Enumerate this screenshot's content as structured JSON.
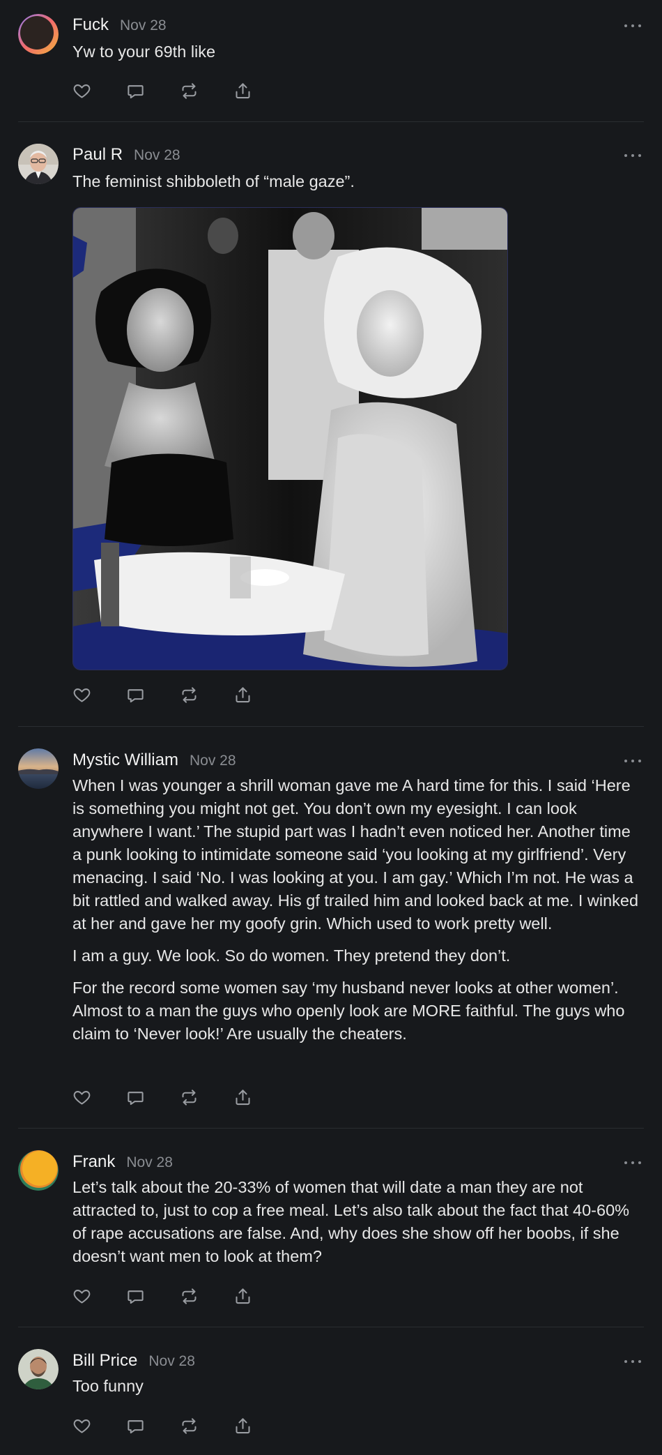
{
  "posts": [
    {
      "author": "Fuck",
      "date": "Nov 28",
      "paragraphs": [
        "Yw to your 69th like"
      ]
    },
    {
      "author": "Paul R",
      "date": "Nov 28",
      "paragraphs": [
        "The feminist shibboleth of “male gaze”."
      ]
    },
    {
      "author": "Mystic William",
      "date": "Nov 28",
      "paragraphs": [
        "When I was younger a shrill woman gave me A hard time for this. I said ‘Here is something you might not get. You don’t own my eyesight. I can look anywhere I want.’ The stupid part was I hadn’t even noticed her. Another time a punk looking to intimidate someone said ‘you looking at my girlfriend’. Very menacing. I said ‘No. I was looking at you. I am gay.’ Which I’m not. He was a bit rattled and walked away. His gf trailed him and looked back at me. I winked at her and gave her my goofy grin. Which used to work pretty well.",
        "I am a guy. We look. So do women. They pretend they don’t.",
        "For the record some women say ‘my husband never looks at other women’. Almost to a man the guys who openly look are MORE faithful. The guys who claim to ‘Never look!’ Are usually the cheaters."
      ]
    },
    {
      "author": "Frank",
      "date": "Nov 28",
      "paragraphs": [
        "Let’s talk about the 20-33% of women that will date a man they are not attracted to, just to cop a free meal. Let’s also talk about the fact that 40-60% of rape accusations are false. And, why does she show off her boobs, if she doesn’t want men to look at them?"
      ]
    },
    {
      "author": "Bill Price",
      "date": "Nov 28",
      "paragraphs": [
        "Too funny"
      ]
    }
  ],
  "icons": {
    "like": "heart-icon",
    "reply": "comment-icon",
    "restack": "restack-icon",
    "share": "share-icon",
    "more": "more-options-icon"
  },
  "colors": {
    "background": "#17191c",
    "text": "#e7e7e7",
    "muted": "#8a8d92",
    "divider": "#2a2d31"
  }
}
